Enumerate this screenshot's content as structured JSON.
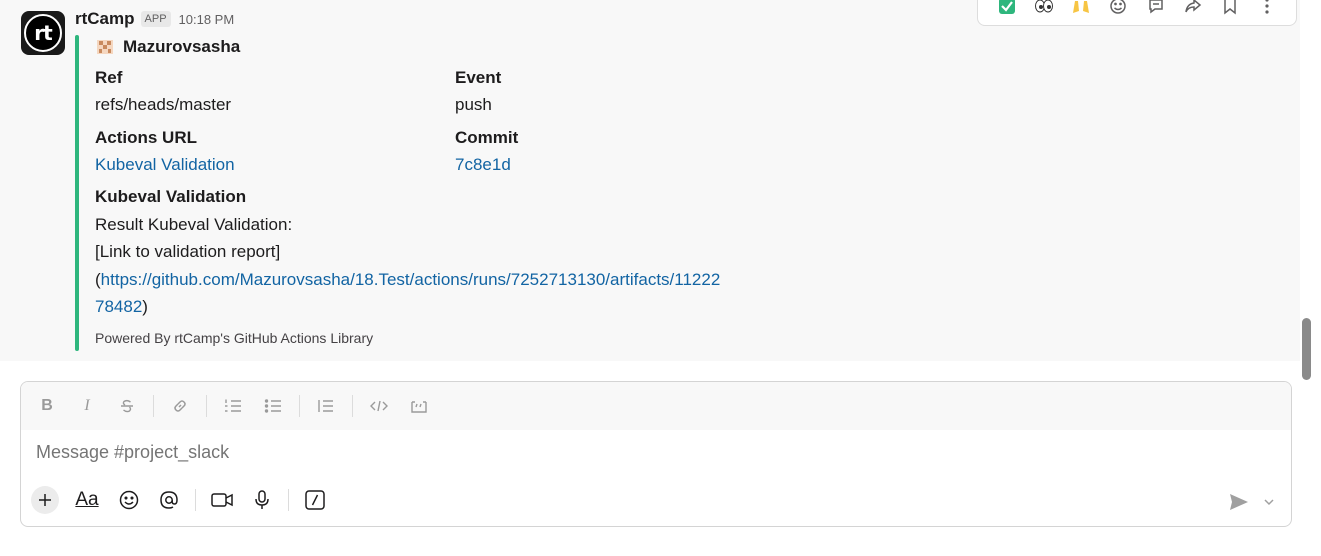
{
  "message": {
    "avatar_text": "rt",
    "sender": "rtCamp",
    "badge": "APP",
    "time": "10:18 PM",
    "attachment": {
      "author": "Mazurovsasha",
      "fields": [
        {
          "name": "Ref",
          "value": "refs/heads/master",
          "is_link": false
        },
        {
          "name": "Event",
          "value": "push",
          "is_link": false
        },
        {
          "name": "Actions URL",
          "value": "Kubeval Validation",
          "is_link": true
        },
        {
          "name": "Commit",
          "value": "7c8e1d",
          "is_link": true
        }
      ],
      "section_title": "Kubeval Validation",
      "section_line1": "Result Kubeval Validation:",
      "section_line2": "[Link to validation report]",
      "paren_open": "(",
      "url_line1": "https://github.com/Mazurovsasha/18.Test/actions/runs/7252713130/artifacts/11222",
      "url_line2": "78482",
      "paren_close": ")",
      "footer": "Powered By rtCamp's GitHub Actions Library"
    }
  },
  "hover_toolbar": {
    "icons": [
      "check-mark-emoji-icon",
      "eyes-emoji-icon",
      "raised-hands-emoji-icon",
      "add-reaction-icon",
      "reply-in-thread-icon",
      "forward-icon",
      "bookmark-icon",
      "more-actions-icon"
    ]
  },
  "composer": {
    "placeholder": "Message #project_slack",
    "format_icons": [
      "bold-icon",
      "italic-icon",
      "strikethrough-icon",
      "link-icon",
      "ordered-list-icon",
      "bullet-list-icon",
      "blockquote-icon",
      "code-icon",
      "code-block-icon"
    ],
    "bottom_icons": [
      "plus-icon",
      "text-format-icon",
      "emoji-icon",
      "mention-icon",
      "video-icon",
      "microphone-icon",
      "slash-command-icon"
    ],
    "format_letters": {
      "bold": "B",
      "italic": "I",
      "aa": "Aa"
    }
  },
  "colors": {
    "accent_bar": "#2eb67d",
    "link": "#1264a3",
    "check": "#2eb67d"
  }
}
